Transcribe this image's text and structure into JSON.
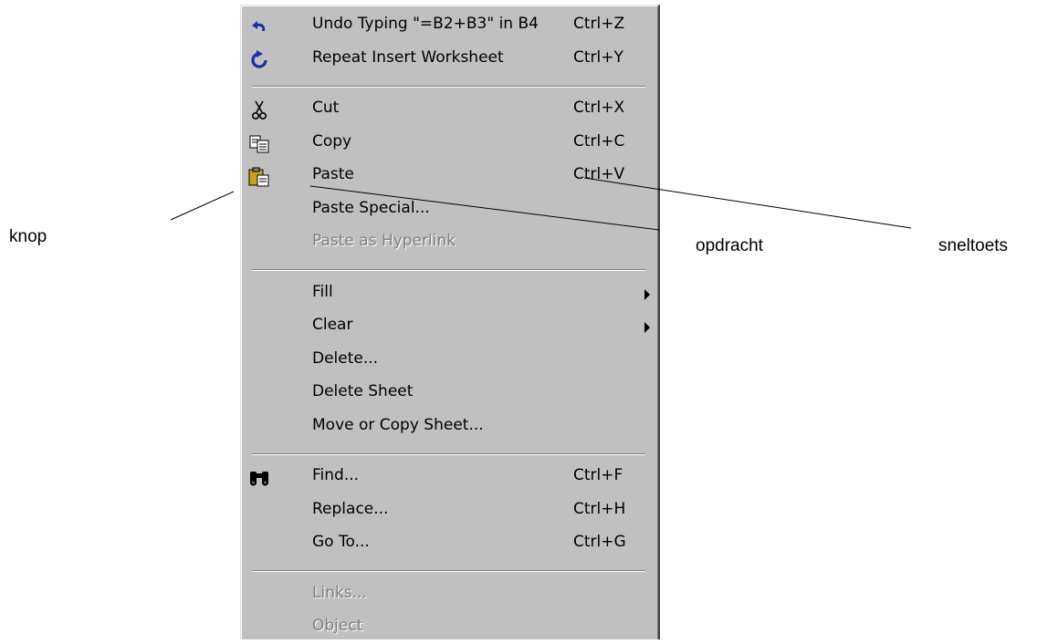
{
  "menu": {
    "groups": [
      [
        {
          "id": "undo",
          "label": "Undo Typing \"=B2+B3\" in B4",
          "shortcut": "Ctrl+Z",
          "icon": "undo-icon",
          "enabled": true
        },
        {
          "id": "repeat",
          "label": "Repeat Insert Worksheet",
          "shortcut": "Ctrl+Y",
          "icon": "repeat-icon",
          "enabled": true
        }
      ],
      [
        {
          "id": "cut",
          "label": "Cut",
          "shortcut": "Ctrl+X",
          "icon": "scissors-icon",
          "enabled": true
        },
        {
          "id": "copy",
          "label": "Copy",
          "shortcut": "Ctrl+C",
          "icon": "copy-icon",
          "enabled": true
        },
        {
          "id": "paste",
          "label": "Paste",
          "shortcut": "Ctrl+V",
          "icon": "paste-icon",
          "enabled": true
        },
        {
          "id": "paste-special",
          "label": "Paste Special...",
          "enabled": true
        },
        {
          "id": "paste-as-hyperlink",
          "label": "Paste as Hyperlink",
          "enabled": false
        }
      ],
      [
        {
          "id": "fill",
          "label": "Fill",
          "submenu": true,
          "enabled": true
        },
        {
          "id": "clear",
          "label": "Clear",
          "submenu": true,
          "enabled": true
        },
        {
          "id": "delete",
          "label": "Delete...",
          "enabled": true
        },
        {
          "id": "delete-sheet",
          "label": "Delete Sheet",
          "enabled": true
        },
        {
          "id": "move-copy-sheet",
          "label": "Move or Copy Sheet...",
          "enabled": true
        }
      ],
      [
        {
          "id": "find",
          "label": "Find...",
          "shortcut": "Ctrl+F",
          "icon": "binoculars-icon",
          "enabled": true
        },
        {
          "id": "replace",
          "label": "Replace...",
          "shortcut": "Ctrl+H",
          "enabled": true
        },
        {
          "id": "goto",
          "label": "Go To...",
          "shortcut": "Ctrl+G",
          "enabled": true
        }
      ],
      [
        {
          "id": "links",
          "label": "Links...",
          "enabled": false
        },
        {
          "id": "object",
          "label": "Object",
          "enabled": false
        }
      ]
    ]
  },
  "callouts": {
    "button": "knop",
    "command": "opdracht",
    "shortcut": "sneltoets"
  },
  "colors": {
    "menu_bg": "#c0c0c0",
    "disabled_text": "#808080",
    "repeat_icon": "#1a2fa6",
    "paste_icon": "#c8a020"
  }
}
